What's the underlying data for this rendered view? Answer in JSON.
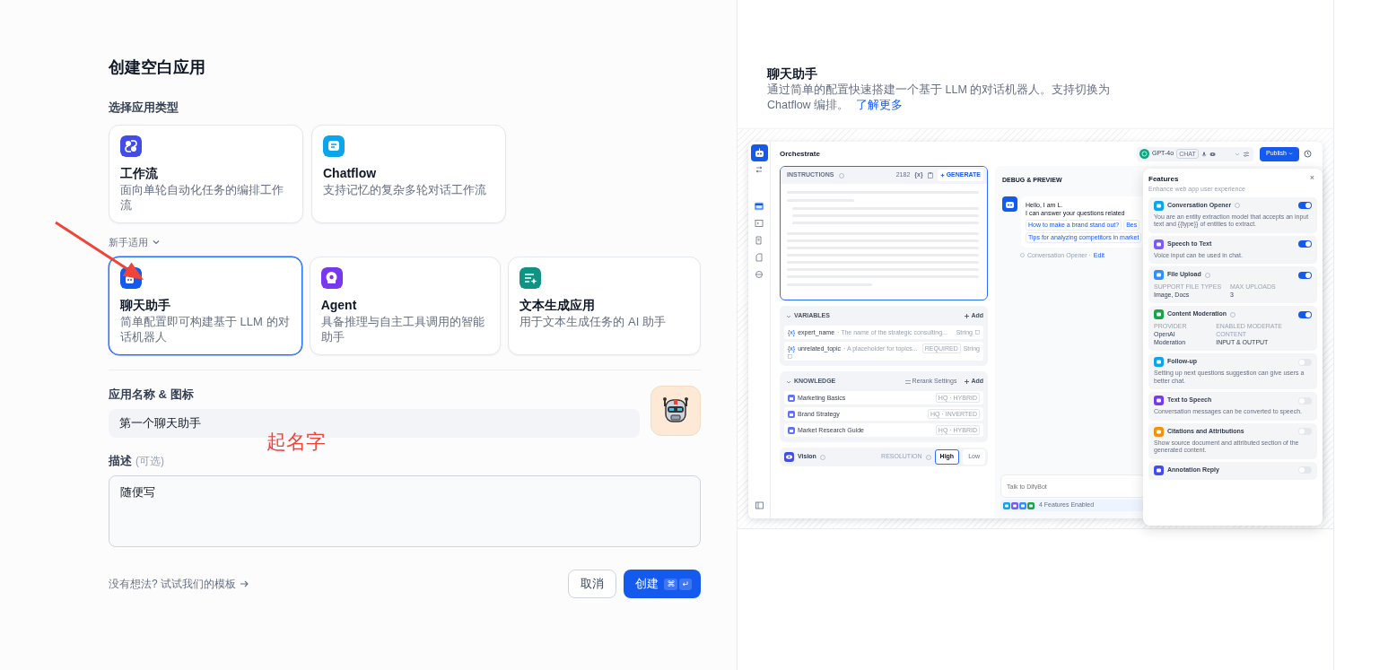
{
  "create": {
    "title": "创建空白应用",
    "type_label": "选择应用类型",
    "types": [
      {
        "name": "工作流",
        "desc": "面向单轮自动化任务的编排工作流",
        "color": "#444ce7",
        "selected": false
      },
      {
        "name": "Chatflow",
        "desc": "支持记忆的复杂多轮对话工作流",
        "color": "#0ba5ec",
        "selected": false
      }
    ],
    "beginner": {
      "label": "新手适用",
      "expanded": true
    },
    "beginner_types": [
      {
        "name": "聊天助手",
        "desc": "简单配置即可构建基于 LLM 的对话机器人",
        "color": "#155aef",
        "selected": true
      },
      {
        "name": "Agent",
        "desc": "具备推理与自主工具调用的智能助手",
        "color": "#7839ee",
        "selected": false
      },
      {
        "name": "文本生成应用",
        "desc": "用于文本生成任务的 AI 助手",
        "color": "#0e9384",
        "selected": false
      }
    ],
    "name_label": "应用名称 & 图标",
    "name_value": "第一个聊天助手",
    "desc_label": "描述",
    "desc_hint": "(可选)",
    "desc_value": "随便写",
    "template_link": "没有想法? 试试我们的模板",
    "cancel": "取消",
    "create": "创建",
    "shortcut": [
      "⌘",
      "↵"
    ]
  },
  "annotation": {
    "text": "起名字"
  },
  "info": {
    "title": "聊天助手",
    "desc": "通过简单的配置快速搭建一个基于 LLM 的对话机器人。支持切换为 Chatflow 编排。",
    "link": "了解更多"
  },
  "preview": {
    "header_title": "Orchestrate",
    "model": "GPT-4o",
    "model_badge": "CHAT",
    "publish": "Publish",
    "instructions": {
      "label": "INSTRUCTIONS",
      "count": "2182",
      "var_button": "{x}",
      "generate": "GENERATE"
    },
    "variables": {
      "label": "VARIABLES",
      "add": "Add",
      "items": [
        {
          "token": "{x}",
          "name": "expert_name",
          "desc": "· The name of the strategic consulting...",
          "type": "String"
        },
        {
          "token": "{x}",
          "name": "unrelated_topic",
          "desc": "· A placeholder for topics...",
          "required": "REQUIRED",
          "type": "String"
        }
      ]
    },
    "knowledge": {
      "label": "KNOWLEDGE",
      "rerank": "Rerank Settings",
      "add": "Add",
      "items": [
        {
          "name": "Marketing Basics",
          "badge": "HQ · HYBRID"
        },
        {
          "name": "Brand Strategy",
          "badge": "HQ · INVERTED"
        },
        {
          "name": "Market Research Guide",
          "badge": "HQ · HYBRID"
        }
      ]
    },
    "vision": {
      "label": "Vision",
      "resolution_label": "RESOLUTION",
      "options": [
        {
          "label": "High",
          "selected": true
        },
        {
          "label": "Low",
          "selected": false
        }
      ]
    },
    "debug": {
      "title": "DEBUG & PREVIEW",
      "greeting": "Hello, I am L.",
      "intro": "I can answer your questions related",
      "suggestions": [
        "How to make a brand stand out?",
        "Bes",
        "Tips for analyzing competitors in market"
      ],
      "opener_label": "Conversation Opener ·",
      "edit": "Edit",
      "input_placeholder": "Talk to DifyBot",
      "features_enabled": "4 Features Enabled"
    },
    "features": {
      "title": "Features",
      "subtitle": "Enhance web app user experience",
      "close": "×",
      "items": [
        {
          "name": "Conversation Opener",
          "help": true,
          "on": true,
          "color": "#0ba5ec",
          "desc": "You are an entity extraction model that accepts an input text and {{type}} of entities to extract."
        },
        {
          "name": "Speech to Text",
          "help": false,
          "on": true,
          "color": "#7a5af8",
          "desc": "Voice input can be used in chat."
        },
        {
          "name": "File Upload",
          "help": true,
          "on": true,
          "color": "#2e90fa",
          "fields": [
            {
              "label": "SUPPORT FILE TYPES",
              "value": "Image, Docs"
            },
            {
              "label": "MAX UPLOADS",
              "value": "3"
            }
          ]
        },
        {
          "name": "Content Moderation",
          "help": true,
          "on": true,
          "color": "#16a34a",
          "fields": [
            {
              "label": "PROVIDER",
              "value": "OpenAI Moderation"
            },
            {
              "label": "ENABLED MODERATE CONTENT",
              "value": "INPUT & OUTPUT"
            }
          ]
        },
        {
          "name": "Follow-up",
          "help": false,
          "on": false,
          "color": "#0ba5ec",
          "desc": "Setting up next questions suggestion can give users a better chat."
        },
        {
          "name": "Text to Speech",
          "help": false,
          "on": false,
          "color": "#7839ee",
          "desc": "Conversation messages can be converted to speech."
        },
        {
          "name": "Citations and Attributions",
          "help": false,
          "on": false,
          "color": "#f79009",
          "desc": "Show source document and attributed section of the generated content."
        },
        {
          "name": "Annotation Reply",
          "help": false,
          "on": false,
          "color": "#444ce7"
        }
      ]
    }
  }
}
